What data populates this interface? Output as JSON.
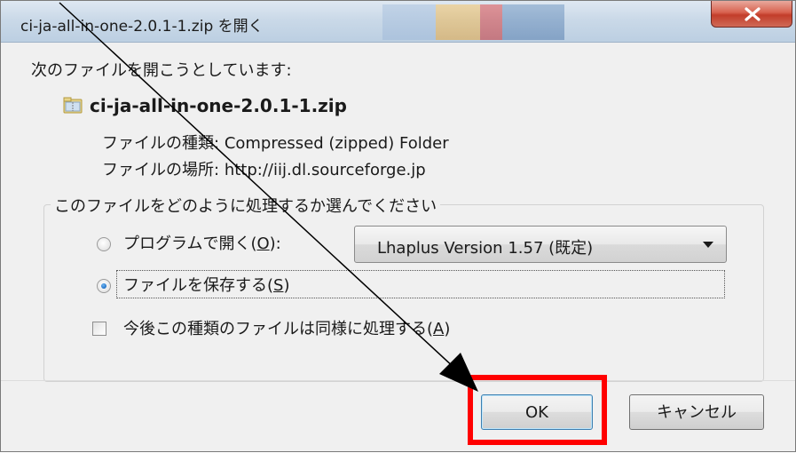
{
  "window": {
    "title": "ci-ja-all-in-one-2.0.1-1.zip を開く",
    "close_glyph": "✕"
  },
  "intro": "次のファイルを開こうとしています:",
  "file": {
    "name": "ci-ja-all-in-one-2.0.1-1.zip",
    "icon": "zip-folder-icon",
    "type_label": "ファイルの種類:",
    "type_value": "Compressed (zipped) Folder",
    "location_label": "ファイルの場所:",
    "location_value": "http://iij.dl.sourceforge.jp"
  },
  "choice_group": {
    "legend": "このファイルをどのように処理するか選んでください",
    "open_with": {
      "label_pre": "プログラムで開く(",
      "key": "O",
      "label_post": "):",
      "selected": false,
      "program": "Lhaplus Version 1.57 (既定)"
    },
    "save_file": {
      "label_pre": "ファイルを保存する(",
      "key": "S",
      "label_post": ")",
      "selected": true
    },
    "remember": {
      "label_pre": "今後この種類のファイルは同様に処理する(",
      "key": "A",
      "label_post": ")",
      "checked": false
    }
  },
  "buttons": {
    "ok": "OK",
    "cancel": "キャンセル"
  },
  "colors": {
    "highlight": "#ff0000",
    "arrow": "#000000"
  }
}
